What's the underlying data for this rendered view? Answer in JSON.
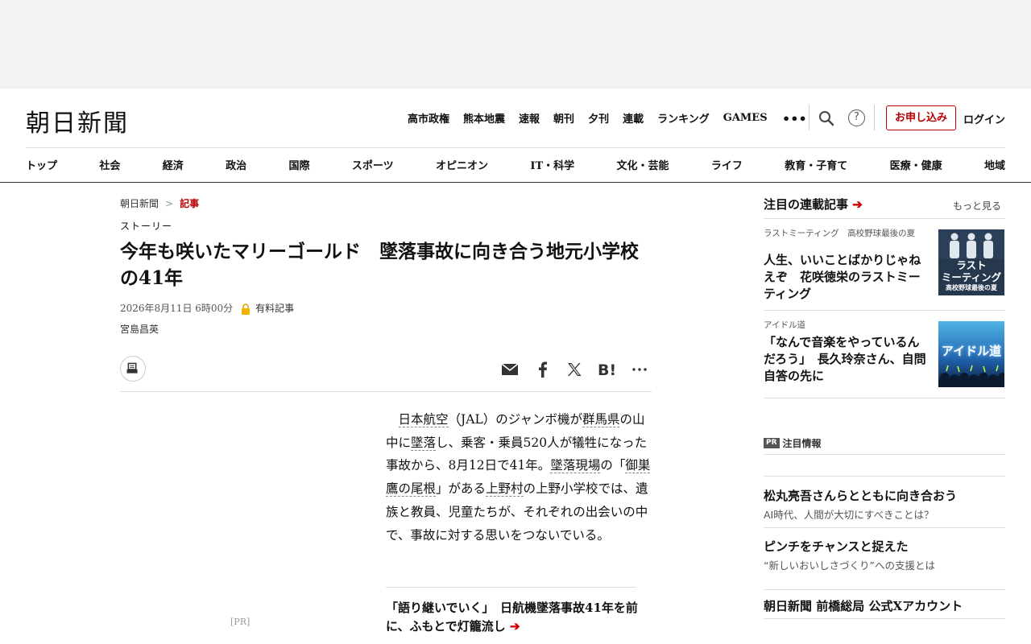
{
  "header": {
    "logo": "朝日新聞",
    "top_links": [
      "高市政権",
      "熊本地震",
      "速報",
      "朝刊",
      "夕刊",
      "連載",
      "ランキング"
    ],
    "games": "GAMES",
    "more": "•••",
    "help": "?",
    "subscribe": "お申し込み",
    "login": "ログイン"
  },
  "categories": [
    "トップ",
    "社会",
    "経済",
    "政治",
    "国際",
    "スポーツ",
    "オピニオン",
    "IT・科学",
    "文化・芸能",
    "ライフ",
    "教育・子育て",
    "医療・健康",
    "地域"
  ],
  "breadcrumb": {
    "home": "朝日新聞",
    "separator": ">",
    "current": "記事"
  },
  "article": {
    "label": "ストーリー",
    "headline": "今年も咲いたマリーゴールド　墜落事故に向き合う地元小学校の41年",
    "date": "2026年8月11日 6時00分",
    "paid": "有料記事",
    "author": "宮島昌英",
    "pr": "[PR]",
    "body": {
      "p1": "日本航空",
      "p2": "（JAL）のジャンボ機が",
      "p3": "群馬県",
      "p4": "の山中に",
      "p5": "墜落",
      "p6": "し、乗客・乗員520人が犠牲になった事故から、8月12日で41年。",
      "p7": "墜落現場",
      "p8": "の「",
      "p9": "御巣鷹の尾根",
      "p10": "」がある",
      "p11": "上野村",
      "p12": "の上野小学校では、遺族と教員、児童たちが、それぞれの出会いの中で、事故に対する思いをつないでいる。"
    },
    "related": "「語り継いでいく」　日航機墜落事故41年を前に、ふもとで灯籠流し",
    "related_arrow": "➔"
  },
  "sidebar": {
    "title": "注目の連載記事",
    "title_arrow": "➔",
    "more": "もっと見る",
    "items": [
      {
        "series": "ラストミーティング　高校野球最後の夏",
        "headline": "人生、いいことばかりじゃねえぞ　花咲徳栄のラストミーティング",
        "thumb_text1": "ラスト",
        "thumb_text2": "ミーティング",
        "thumb_text3": "高校野球最後の夏"
      },
      {
        "series": "アイドル道",
        "headline": "「なんで音楽をやっているんだろう」　長久玲奈さん、自問自答の先に",
        "thumb_text1": "アイドル道"
      }
    ],
    "pr_badge": "PR",
    "pr_heading": "注目情報",
    "pr_items": [
      {
        "title": "松丸亮吾さんらとともに向き合おう",
        "sub": "AI時代、人間が大切にすべきことは？"
      },
      {
        "title": "ピンチをチャンスと捉えた",
        "sub": "“新しいおいしさづくり”への支援とは"
      }
    ],
    "x_account": "朝日新聞 前橋総局 公式Xアカウント"
  },
  "colors": {
    "accent": "#b00000",
    "text": "#111111",
    "muted": "#555555"
  }
}
